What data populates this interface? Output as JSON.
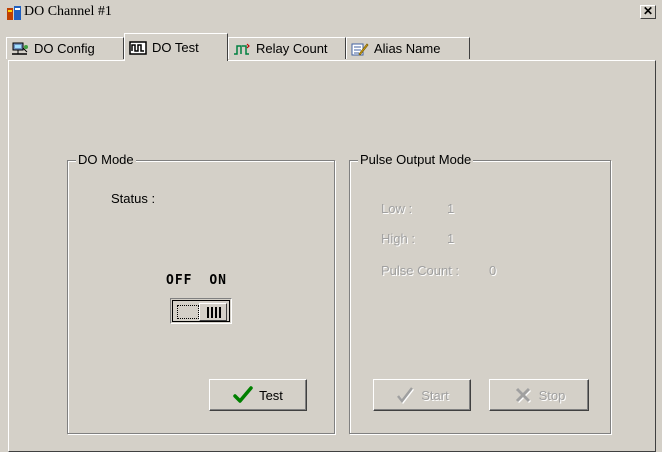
{
  "window": {
    "title": "DO Channel #1"
  },
  "tabs": [
    {
      "label": "DO Config",
      "icon": "network-config-icon"
    },
    {
      "label": "DO Test",
      "icon": "waveform-icon"
    },
    {
      "label": "Relay Count",
      "icon": "pulse-icon"
    },
    {
      "label": "Alias Name",
      "icon": "notepad-pencil-icon"
    }
  ],
  "active_tab": "DO Test",
  "do_mode": {
    "title": "DO Mode",
    "status_label": "Status :",
    "switch_off_label": "OFF",
    "switch_on_label": "ON",
    "switch_state": "ON",
    "test_button": "Test"
  },
  "pulse_mode": {
    "title": "Pulse Output Mode",
    "low_label": "Low :",
    "low_value": "1",
    "high_label": "High :",
    "high_value": "1",
    "pulse_count_label": "Pulse Count :",
    "pulse_count_value": "0",
    "start_button": "Start",
    "stop_button": "Stop",
    "enabled": false
  }
}
